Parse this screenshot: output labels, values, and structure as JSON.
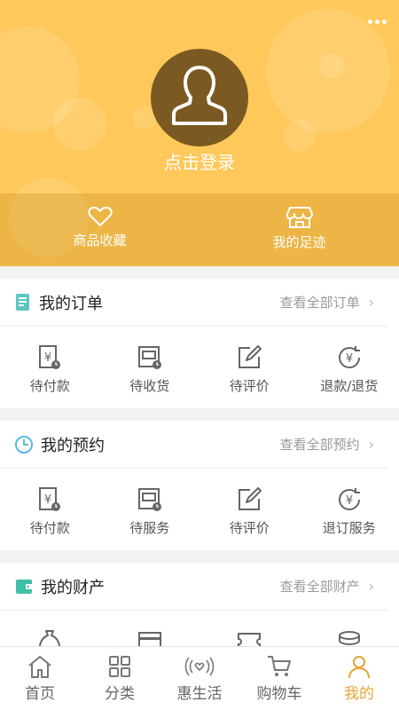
{
  "header": {
    "login_text": "点击登录",
    "favorites_label": "商品收藏",
    "footprints_label": "我的足迹"
  },
  "orders": {
    "title": "我的订单",
    "link": "查看全部订单",
    "items": [
      "待付款",
      "待收货",
      "待评价",
      "退款/退货"
    ]
  },
  "appointments": {
    "title": "我的预约",
    "link": "查看全部预约",
    "items": [
      "待付款",
      "待服务",
      "待评价",
      "退订服务"
    ]
  },
  "assets": {
    "title": "我的财产",
    "link": "查看全部财产"
  },
  "tabbar": {
    "items": [
      "首页",
      "分类",
      "惠生活",
      "购物车",
      "我的"
    ],
    "active_index": 4
  },
  "colors": {
    "header_bg": "#ffc85a",
    "accent": "#e5a535",
    "avatar_bg": "#7a5a22"
  },
  "icons": {
    "orders": "document-icon",
    "appointments": "clock-icon",
    "assets": "wallet-icon"
  }
}
